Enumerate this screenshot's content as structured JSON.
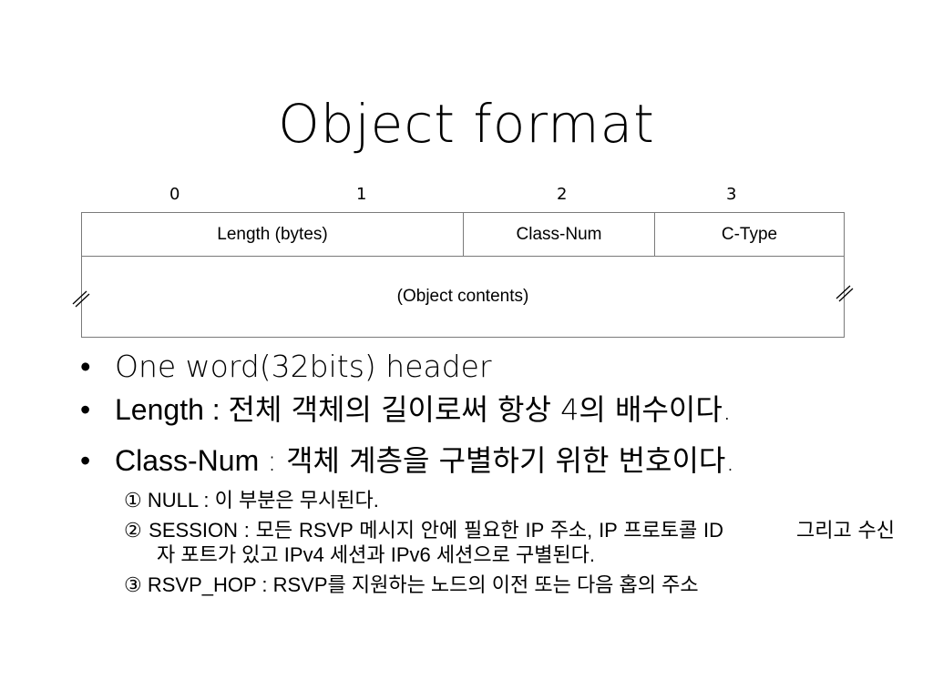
{
  "slide": {
    "title": "Object format"
  },
  "diagram": {
    "bit_labels": [
      "0",
      "1",
      "2",
      "3"
    ],
    "fields": {
      "length": "Length (bytes)",
      "class_num": "Class-Num",
      "c_type": "C-Type",
      "contents": "(Object contents)"
    }
  },
  "bullets": {
    "b1": "One word(32bits) header",
    "b2_term": "Length : ",
    "b2_text": "전체 객체의 길이로써 항상 4의 배수이다.",
    "b3_term": "Class-Num ",
    "b3_text": ": 객체 계층을 구별하기 위한 번호이다.",
    "subs": {
      "s1": "① NULL : 이 부분은 무시된다.",
      "s2_a": "② SESSION : 모든 RSVP 메시지 안에 필요한 IP 주소, IP 프로토콜 ID",
      "s2_b": "그리고 수신자 포트가 있고 IPv4 세션과 IPv6 세션으로 구별된다.",
      "s3": "③ RSVP_HOP : RSVP를 지원하는 노드의 이전 또는 다음 홉의 주소"
    }
  }
}
